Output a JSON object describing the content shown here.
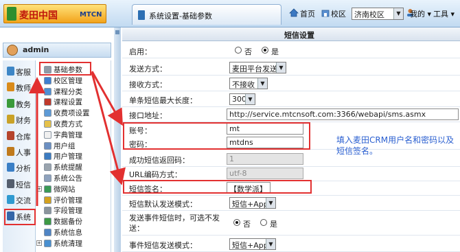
{
  "header": {
    "logo_text": "麦田中国",
    "logo_tag": "MTCN",
    "tab_title": "系统设置-基础参数",
    "home": "首页",
    "campus_label": "校区",
    "campus_selected": "济南校区",
    "mine": "我的",
    "tools": "工具"
  },
  "user": {
    "name": "admin"
  },
  "left_nav": [
    {
      "label": "客服",
      "icon": "headset-icon",
      "color": "#3d86c6"
    },
    {
      "label": "教师",
      "icon": "book-icon",
      "color": "#d98b1b"
    },
    {
      "label": "教务",
      "icon": "people-icon",
      "color": "#3a9a3a"
    },
    {
      "label": "财务",
      "icon": "coins-icon",
      "color": "#c9a227"
    },
    {
      "label": "仓库",
      "icon": "warehouse-icon",
      "color": "#b5442c"
    },
    {
      "label": "人事",
      "icon": "person-icon",
      "color": "#c07a1c"
    },
    {
      "label": "分析",
      "icon": "chart-icon",
      "color": "#3a7fc6"
    },
    {
      "label": "短信",
      "icon": "phone-icon",
      "color": "#555f6e"
    },
    {
      "label": "交流",
      "icon": "chat-icon",
      "color": "#2f9ad0"
    },
    {
      "label": "系统",
      "icon": "system-icon",
      "color": "#3566a8"
    }
  ],
  "tree": [
    {
      "label": "基础参数",
      "color": "#8f9aa6",
      "plus": false
    },
    {
      "label": "校区管理",
      "color": "#3f7fd0",
      "plus": false
    },
    {
      "label": "课程分类",
      "color": "#4f8fd4",
      "plus": false
    },
    {
      "label": "课程设置",
      "color": "#c0392b",
      "plus": false
    },
    {
      "label": "收费项设置",
      "color": "#5d9ad6",
      "plus": false
    },
    {
      "label": "收费方式",
      "color": "#e5c14a",
      "plus": false
    },
    {
      "label": "字典管理",
      "color": "#f0f0f0",
      "plus": false
    },
    {
      "label": "用户组",
      "color": "#6b8fc2",
      "plus": false
    },
    {
      "label": "用户管理",
      "color": "#3c7bc0",
      "plus": false
    },
    {
      "label": "系统提醒",
      "color": "#9aa4ae",
      "plus": false
    },
    {
      "label": "系统公告",
      "color": "#8ea2bd",
      "plus": false
    },
    {
      "label": "微网站",
      "color": "#3a9a55",
      "plus": true
    },
    {
      "label": "评价管理",
      "color": "#d4a11e",
      "plus": false
    },
    {
      "label": "字段管理",
      "color": "#8b949c",
      "plus": false
    },
    {
      "label": "数据备份",
      "color": "#3d9944",
      "plus": false
    },
    {
      "label": "系统信息",
      "color": "#4f84c4",
      "plus": false
    },
    {
      "label": "系统清理",
      "color": "#4a90d0",
      "plus": true
    }
  ],
  "settings": {
    "title": "短信设置",
    "enabled": {
      "label": "启用：",
      "opt_no": "否",
      "opt_yes": "是",
      "selected": "yes"
    },
    "send_mode": {
      "label": "发送方式：",
      "value": "麦田平台发送"
    },
    "receive_mode": {
      "label": "接收方式：",
      "value": "不接收"
    },
    "max_length": {
      "label": "单条短信最大长度：",
      "value": "300"
    },
    "api_url": {
      "label": "接口地址：",
      "value": "http://service.mtcnsoft.com:3366/webapi/sms.asmx"
    },
    "account": {
      "label": "账号：",
      "value": "mt"
    },
    "password": {
      "label": "密码：",
      "value": "mtdns"
    },
    "success_code": {
      "label": "成功短信返回码：",
      "value": "1"
    },
    "url_encoding": {
      "label": "URL编码方式：",
      "value": "utf-8"
    },
    "signature": {
      "label": "短信签名：",
      "value": "【数学派】"
    },
    "default_mode": {
      "label": "短信默认发送模式：",
      "value": "短信+App"
    },
    "send_on_event": {
      "label": "发送事件短信时，可选不发送：",
      "opt_no": "否",
      "opt_yes": "是",
      "selected": "no"
    },
    "event_mode": {
      "label": "事件短信发送模式：",
      "value": "短信+App"
    }
  },
  "annotation": {
    "text": "填入麦田CRM用户名和密码以及短信签名。"
  },
  "colors": {
    "accent_red": "#e23030",
    "note_blue": "#2a5fd0"
  }
}
